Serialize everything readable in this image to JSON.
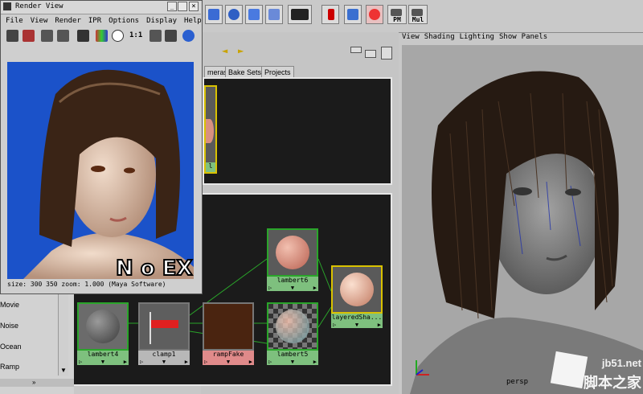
{
  "render_view": {
    "title": "Render View",
    "menu": [
      "File",
      "View",
      "Render",
      "IPR",
      "Options",
      "Display",
      "Help"
    ],
    "ratio_label": "1:1",
    "status": "size:  300  350 zoom: 1.000  (Maya Software)",
    "logo_text": "N o EX"
  },
  "shelf": {
    "icons": [
      "render-frame-icon",
      "ipr-icon",
      "render-settings-icon",
      "hypershade-icon",
      "render-view-icon",
      "lights-icon",
      "paint-effects-icon",
      "pm-icon",
      "mul-icon"
    ],
    "pm_label": "PM",
    "mul_label": "Mul"
  },
  "hypershade": {
    "tabs": [
      "meras",
      "Bake Sets",
      "Projects"
    ],
    "nodes": {
      "lambert4": "lambert4",
      "clamp1": "clamp1",
      "rampFake": "rampFake",
      "lambert5": "lambert5",
      "lambert6": "lambert6",
      "layered": "layeredSha..."
    },
    "top_node_label": "l"
  },
  "texture_list": {
    "items": [
      "Movie",
      "Noise",
      "Ocean",
      "Ramp"
    ]
  },
  "viewport": {
    "menu": [
      "View",
      "Shading",
      "Lighting",
      "Show",
      "Panels"
    ],
    "camera": "persp"
  },
  "watermark": {
    "url": "jb51.net",
    "text": "脚本之家"
  },
  "colors": {
    "render_bg": "#1b52c9",
    "node_border_green": "#2aa52a",
    "layered_border": "#d9c100",
    "viewport_bg": "#a7a7a7"
  }
}
